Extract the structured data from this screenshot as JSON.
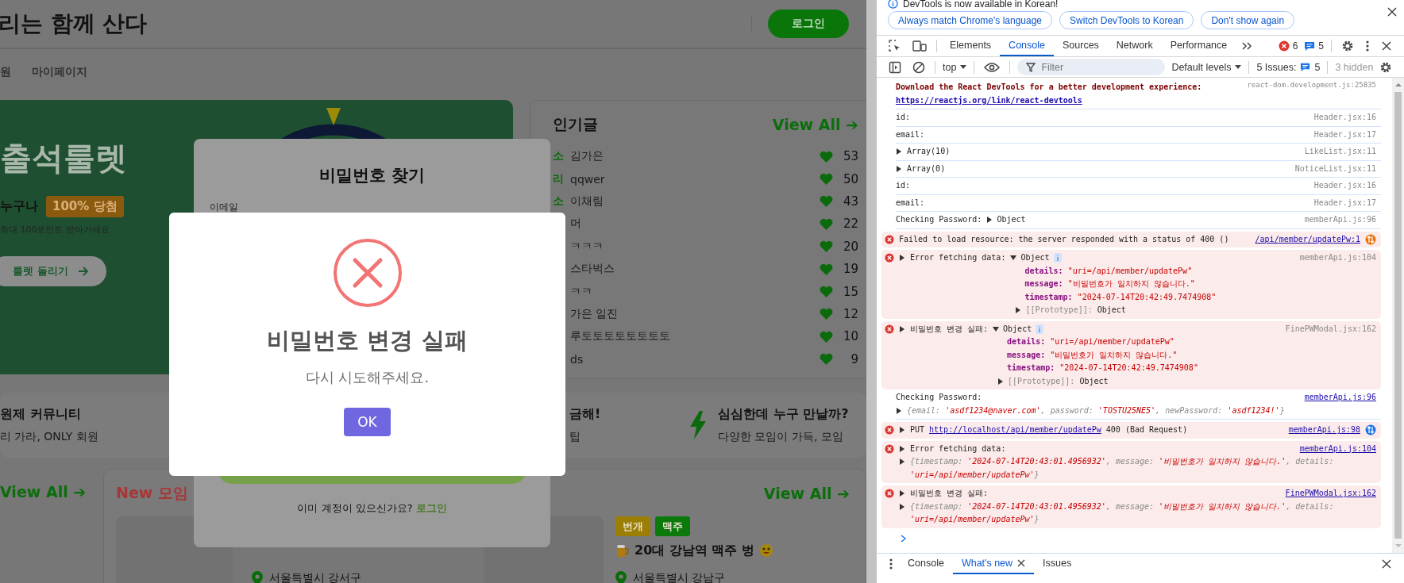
{
  "page": {
    "header": {
      "title": "리는 함께 산다",
      "login_button": "로그인"
    },
    "nav": [
      {
        "label": "원"
      },
      {
        "label": "마이페이지"
      }
    ],
    "hero": {
      "title": "출석룰렛",
      "tagline": "누구나",
      "badge": "100% 당첨",
      "note": "최대 100포인트 받아가세요",
      "button": "룰렛 돌리기"
    },
    "popular": {
      "title": "인기글",
      "view_all": "View All ➔",
      "posts": [
        {
          "category": "소",
          "title": "김가은",
          "likes": "53"
        },
        {
          "category": "리",
          "title": "qqwer",
          "likes": "50"
        },
        {
          "category": "소",
          "title": "이채림",
          "likes": "43"
        },
        {
          "title": "머",
          "likes": "22"
        },
        {
          "title": "ㅋㅋㅋ",
          "likes": "20"
        },
        {
          "title": "스타벅스",
          "likes": "19"
        },
        {
          "title": "ㅋㅋ",
          "likes": "15"
        },
        {
          "title": "가은 일진",
          "likes": "12"
        },
        {
          "title": "루토토토토토토토토",
          "likes": "10"
        },
        {
          "title": "ds",
          "likes": "9"
        }
      ]
    },
    "features": [
      {
        "title": "원제 커뮤니티",
        "subtitle": "리 가라, ONLY 회원"
      },
      {
        "title": "금해!",
        "subtitle": "팁"
      },
      {
        "icon": true,
        "title": "심심한데 누구 만날까?",
        "subtitle": "다양한 모임이 가득, 모임"
      }
    ],
    "view_all": "View All ➔",
    "meetups": {
      "title": "New 모임",
      "view_all": "View All ➔",
      "cards": [
        {
          "location": "서울특별시 강서구"
        },
        {
          "tags": [
            {
              "label": "번개",
              "color": "#9c7d05"
            },
            {
              "label": "맥주",
              "color": "#0b7a0b"
            }
          ],
          "title": "20대 강남역 맥주 벙",
          "location": "서울특별시 강남구"
        }
      ]
    }
  },
  "find_password_modal": {
    "title": "비밀번호 찾기",
    "email_label": "이메일",
    "login_prompt": "이미 계정이 있으신가요?",
    "login_link": "로그인"
  },
  "alert": {
    "kind": "error",
    "title": "비밀번호 변경 실패",
    "text": "다시 시도해주세요.",
    "button": "OK"
  },
  "devtools": {
    "infobar": {
      "message": "DevTools is now available in Korean!",
      "buttons": [
        "Always match Chrome's language",
        "Switch DevTools to Korean",
        "Don't show again"
      ]
    },
    "tabs": [
      {
        "label": "Elements",
        "selected": false
      },
      {
        "label": "Console",
        "selected": true
      },
      {
        "label": "Sources",
        "selected": false
      },
      {
        "label": "Network",
        "selected": false
      },
      {
        "label": "Performance",
        "selected": false
      }
    ],
    "error_count": "6",
    "message_count": "5",
    "toolbar": {
      "context": "top",
      "filter_placeholder": "Filter",
      "levels": "Default levels",
      "issues_label": "5 Issues:",
      "issues_count": "5",
      "hidden": "3 hidden"
    },
    "messages": [
      {
        "kind": "banner",
        "text": "Download the React DevTools for a better development experience:",
        "link": "https://reactjs.org/link/react-devtools",
        "source": "react-dom.development.js:25835",
        "source_link": false
      },
      {
        "kind": "log",
        "text": "id:",
        "source": "Header.jsx:16",
        "source_link": false
      },
      {
        "kind": "log",
        "text": "email:",
        "source": "Header.jsx:17",
        "source_link": false
      },
      {
        "kind": "log",
        "toggle": {
          "expanded": false
        },
        "text": "Array(10)",
        "source": "LikeList.jsx:11",
        "source_link": false
      },
      {
        "kind": "log",
        "toggle": {
          "expanded": false
        },
        "text": "Array(0)",
        "source": "NoticeList.jsx:11",
        "source_link": false
      },
      {
        "kind": "log",
        "text": "id:",
        "source": "Header.jsx:16",
        "source_link": false
      },
      {
        "kind": "log",
        "text": "email:",
        "source": "Header.jsx:17",
        "source_link": false
      },
      {
        "kind": "log",
        "text": "Checking Password:",
        "object": {
          "label": "Object",
          "expanded": false
        },
        "source": "memberApi.js:96",
        "source_link": false
      },
      {
        "kind": "error",
        "text": "Failed to load resource: the server responded with a status of 400 ()",
        "source": "/api/member/updatePw:1",
        "source_link": true,
        "network": {
          "color": "#e8710a"
        }
      },
      {
        "kind": "error",
        "toggle": {
          "expanded": false
        },
        "text": "Error fetching data:",
        "object": {
          "label": "Object",
          "expanded": true,
          "info": true,
          "properties": [
            {
              "key": "details:",
              "value": "\"uri=/api/member/updatePw\""
            },
            {
              "key": "message:",
              "value": "\"비밀번호가 일치하지 않습니다.\""
            },
            {
              "key": "timestamp:",
              "value": "\"2024-07-14T20:42:49.7474908\""
            }
          ],
          "prototype": {
            "expanded": false,
            "key": "[[Prototype]]:",
            "value": "Object"
          }
        },
        "source": "memberApi.js:104",
        "source_link": false
      },
      {
        "kind": "error",
        "toggle": {
          "expanded": false
        },
        "text": "비밀번호 변경 실패:",
        "object": {
          "label": "Object",
          "expanded": true,
          "info": true,
          "properties": [
            {
              "key": "details:",
              "value": "\"uri=/api/member/updatePw\""
            },
            {
              "key": "message:",
              "value": "\"비밀번호가 일치하지 않습니다.\""
            },
            {
              "key": "timestamp:",
              "value": "\"2024-07-14T20:42:49.7474908\""
            }
          ],
          "prototype": {
            "expanded": false,
            "key": "[[Prototype]]:",
            "value": "Object"
          }
        },
        "source": "FinePWModal.jsx:162",
        "source_link": false
      },
      {
        "kind": "log",
        "text": "Checking Password:",
        "preview": {
          "expanded": false,
          "parts": [
            "{email: ",
            "'asdf1234@naver.com'",
            ", password: ",
            "'TOSTU25NE5'",
            ", newPassword: ",
            "'asdf1234!'",
            "}"
          ]
        },
        "source": "memberApi.js:96",
        "source_link": true
      },
      {
        "kind": "error",
        "toggle": {
          "expanded": false
        },
        "text": "PUT",
        "link": "http://localhost/api/member/updatePw",
        "suffix": "400 (Bad Request)",
        "source": "memberApi.js:98",
        "source_link": true,
        "network": {
          "color": "#1a73e8"
        }
      },
      {
        "kind": "error",
        "toggle": {
          "expanded": false
        },
        "text": "Error fetching data:",
        "preview": {
          "expanded": false,
          "parts": [
            "{timestamp: ",
            "'2024-07-14T20:43:01.4956932'",
            ", message: ",
            "'비밀번호가 일치하지 않습니다.'",
            ", details: ",
            "'uri=/api/member/updatePw'",
            "}"
          ]
        },
        "source": "memberApi.js:104",
        "source_link": true
      },
      {
        "kind": "error",
        "toggle": {
          "expanded": false
        },
        "text": "비밀번호 변경 실패:",
        "preview": {
          "expanded": false,
          "parts": [
            "{timestamp: ",
            "'2024-07-14T20:43:01.4956932'",
            ", message: ",
            "'비밀번호가 일치하지 않습니다.'",
            ", details: ",
            "'uri=/api/member/updatePw'",
            "}"
          ]
        },
        "source": "FinePWModal.jsx:162",
        "source_link": true
      }
    ],
    "drawer_tabs": [
      {
        "label": "Console",
        "selected": false
      },
      {
        "label": "What's new",
        "selected": true,
        "closable": true
      },
      {
        "label": "Issues",
        "selected": false
      }
    ]
  }
}
